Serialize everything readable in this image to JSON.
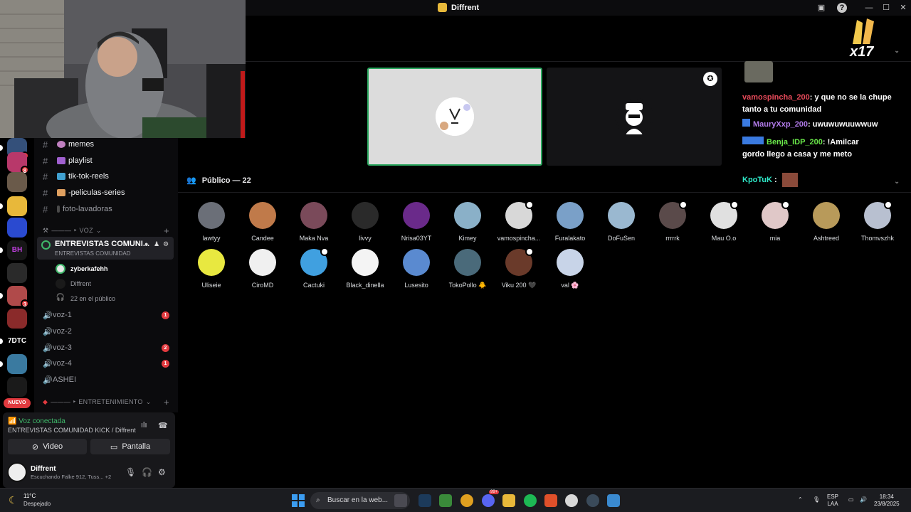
{
  "window": {
    "title": "Diffrent"
  },
  "sidebar": {
    "channels": [
      {
        "label": "memes",
        "type": "text"
      },
      {
        "label": "playlist",
        "type": "text"
      },
      {
        "label": "tik-tok-reels",
        "type": "text"
      },
      {
        "label": "-peliculas-series",
        "type": "text"
      },
      {
        "label": "foto-lavadoras",
        "type": "text"
      }
    ],
    "voice_category": "——— ‣ VOZ",
    "active_voice": {
      "name": "ENTREVISTAS COMUNI...",
      "subtitle": "ENTREVISTAS COMUNIDAD"
    },
    "voice_members": [
      "zyberkafehh",
      "Diffrent"
    ],
    "audience_note": "22 en el público",
    "voice_channels": [
      {
        "label": "voz-1",
        "badge": "1"
      },
      {
        "label": "voz-2",
        "badge": ""
      },
      {
        "label": "voz-3",
        "badge": "2"
      },
      {
        "label": "voz-4",
        "badge": "1"
      },
      {
        "label": "ASHEI",
        "badge": ""
      }
    ],
    "entertainment_category": "——— ‣ ENTRETENIMIENTO",
    "server_badges": [
      "8",
      "8",
      "3"
    ],
    "server_text": "7DTC",
    "new_badge": "NUEVO"
  },
  "voice_panel": {
    "status": "Voz conectada",
    "channel": "ENTREVISTAS COMUNIDAD KICK / Diffrent",
    "video_label": "Video",
    "screen_label": "Pantalla"
  },
  "user_panel": {
    "name": "Diffrent",
    "activity": "Escuchando Falke 912, Tuss... +2"
  },
  "stage": {
    "audience_header": "Público — 22",
    "audience": [
      {
        "name": "lawtyy",
        "color": "#6b6f78"
      },
      {
        "name": "Candee",
        "color": "#c07a4a"
      },
      {
        "name": "Maka Nva",
        "color": "#7a4a5a"
      },
      {
        "name": "livvy",
        "color": "#2a2a2a"
      },
      {
        "name": "Nrisa03YT",
        "color": "#6a2a8a"
      },
      {
        "name": "Kimey",
        "color": "#8ab0c8"
      },
      {
        "name": "vamospincha...",
        "color": "#d8d8d8",
        "mod": true
      },
      {
        "name": "Furalakato",
        "color": "#7aa0c8"
      },
      {
        "name": "DoFuSen",
        "color": "#9ab8d0"
      },
      {
        "name": "rrrrrk",
        "color": "#5a4a4a",
        "mod": true
      },
      {
        "name": "Mau O.o",
        "color": "#e0e0e0",
        "mod": true
      },
      {
        "name": "mia",
        "color": "#e0c8c8",
        "mod": true
      },
      {
        "name": "Ashtreed",
        "color": "#b89a5a"
      },
      {
        "name": "Thomvszhk",
        "color": "#b8c0d0",
        "mod": true
      },
      {
        "name": "Uliseie",
        "color": "#e8e840"
      },
      {
        "name": "CiroMD",
        "color": "#f0f0f0"
      },
      {
        "name": "Cactuki",
        "color": "#40a0e0",
        "mod": true
      },
      {
        "name": "Black_dinella",
        "color": "#f4f4f4"
      },
      {
        "name": "Lusesito",
        "color": "#5a8ad0"
      },
      {
        "name": "TokoPollo 🐥",
        "color": "#4a6a7a"
      },
      {
        "name": "Viku 200 🖤",
        "color": "#6a3a2a",
        "mod": true
      },
      {
        "name": "val 🌸",
        "color": "#c8d4e8"
      }
    ]
  },
  "chat": {
    "messages": [
      {
        "user": "vamospincha_200",
        "user_color": "#e84a5a",
        "text": ": y que no se la chupe tanto a tu comunidad"
      },
      {
        "user": "MauryXxp_200",
        "user_color": "#b07ae8",
        "text": ": uwuwuwuuwwuw"
      },
      {
        "user": "Benja_IDP_200",
        "user_color": "#6ae84a",
        "text": ": !Amilcar gordo llego a casa y me meto"
      },
      {
        "user": "KpoTuK",
        "user_color": "#2ee8c8",
        "text": ":"
      }
    ],
    "overlay_count": "x17"
  },
  "taskbar": {
    "weather_temp": "11°C",
    "weather_text": "Despejado",
    "search_placeholder": "Buscar en la web...",
    "lang_top": "ESP",
    "lang_bottom": "LAA",
    "time": "18:34",
    "date": "23/8/2025",
    "notification_count": "99+"
  }
}
